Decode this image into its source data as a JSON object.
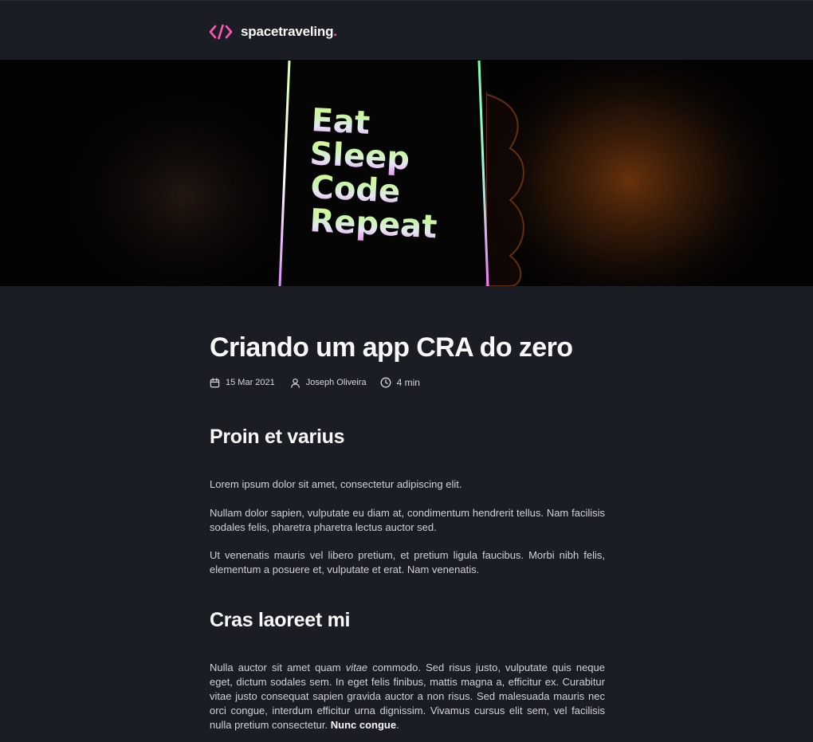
{
  "header": {
    "brand_name": "spacetraveling",
    "brand_dot": ".",
    "accent_color": "#ff57b2",
    "logo_icon": "code-brackets-icon"
  },
  "banner": {
    "alt": "",
    "lines": [
      "Eat",
      "Sleep",
      "Code",
      "Repeat"
    ]
  },
  "post": {
    "title": "Criando um app CRA do zero",
    "date": "15 Mar 2021",
    "author": "Joseph Oliveira",
    "reading_time": "4 min",
    "sections": [
      {
        "heading": "Proin et varius",
        "paragraphs": [
          "Lorem ipsum dolor sit amet, consectetur adipiscing elit.",
          "Nullam dolor sapien, vulputate eu diam at, condimentum hendrerit tellus. Nam facilisis sodales felis, pharetra pharetra lectus auctor sed.",
          "Ut venenatis mauris vel libero pretium, et pretium ligula faucibus. Morbi nibh felis, elementum a posuere et, vulputate et erat. Nam venenatis."
        ]
      },
      {
        "heading": "Cras laoreet mi",
        "paragraph_parts": {
          "before_italic": "Nulla auctor sit amet quam ",
          "italic": "vitae",
          "after_italic": " commodo. Sed risus justo, vulputate quis neque eget, dictum sodales sem. In eget felis finibus, mattis magna a, efficitur ex. Curabitur vitae justo consequat sapien gravida auctor a non risus. Sed malesuada mauris nec orci congue, interdum efficitur urna dignissim. Vivamus cursus elit sem, vel facilisis nulla pretium consectetur. ",
          "bold": "Nunc congue",
          "end": "."
        }
      }
    ]
  }
}
